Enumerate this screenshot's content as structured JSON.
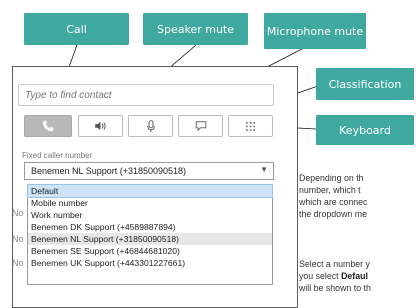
{
  "callouts": {
    "call": "Call",
    "speaker_mute": "Speaker mute",
    "microphone_mute": "Microphone mute",
    "classification": "Classification",
    "keyboard": "Keyboard"
  },
  "search": {
    "placeholder": "Type to find contact"
  },
  "toolbar": {
    "buttons": [
      {
        "icon": "phone-icon"
      },
      {
        "icon": "speaker-icon"
      },
      {
        "icon": "microphone-icon"
      },
      {
        "icon": "speech-bubble-icon"
      },
      {
        "icon": "keypad-icon"
      }
    ]
  },
  "fixed_caller": {
    "label": "Fixed caller number",
    "selected": "Benemen NL Support (+31850090518)",
    "options": [
      "Default",
      "Mobile number",
      "Work number",
      "Benemen DK Support (+4589887894)",
      "Benemen NL Support (+31850090518)",
      "Benemen SE Support (+46844681020)",
      "Benemen UK Support (+443301227661)"
    ]
  },
  "partials": {
    "no1": "No",
    "no2": "No",
    "no3": "No"
  },
  "body": {
    "p1_l1": "Depending on th",
    "p1_l2": "number, which t",
    "p1_l3": "which are connec",
    "p1_l4": "the dropdown me",
    "p2_l1": "Select a number y",
    "p2_l2_pre": "you select ",
    "p2_l2_bold": "Defaul",
    "p2_l3": "will be shown to th"
  },
  "colors": {
    "callout": "#3fa9a0",
    "selected_option": "#cde4f7"
  }
}
